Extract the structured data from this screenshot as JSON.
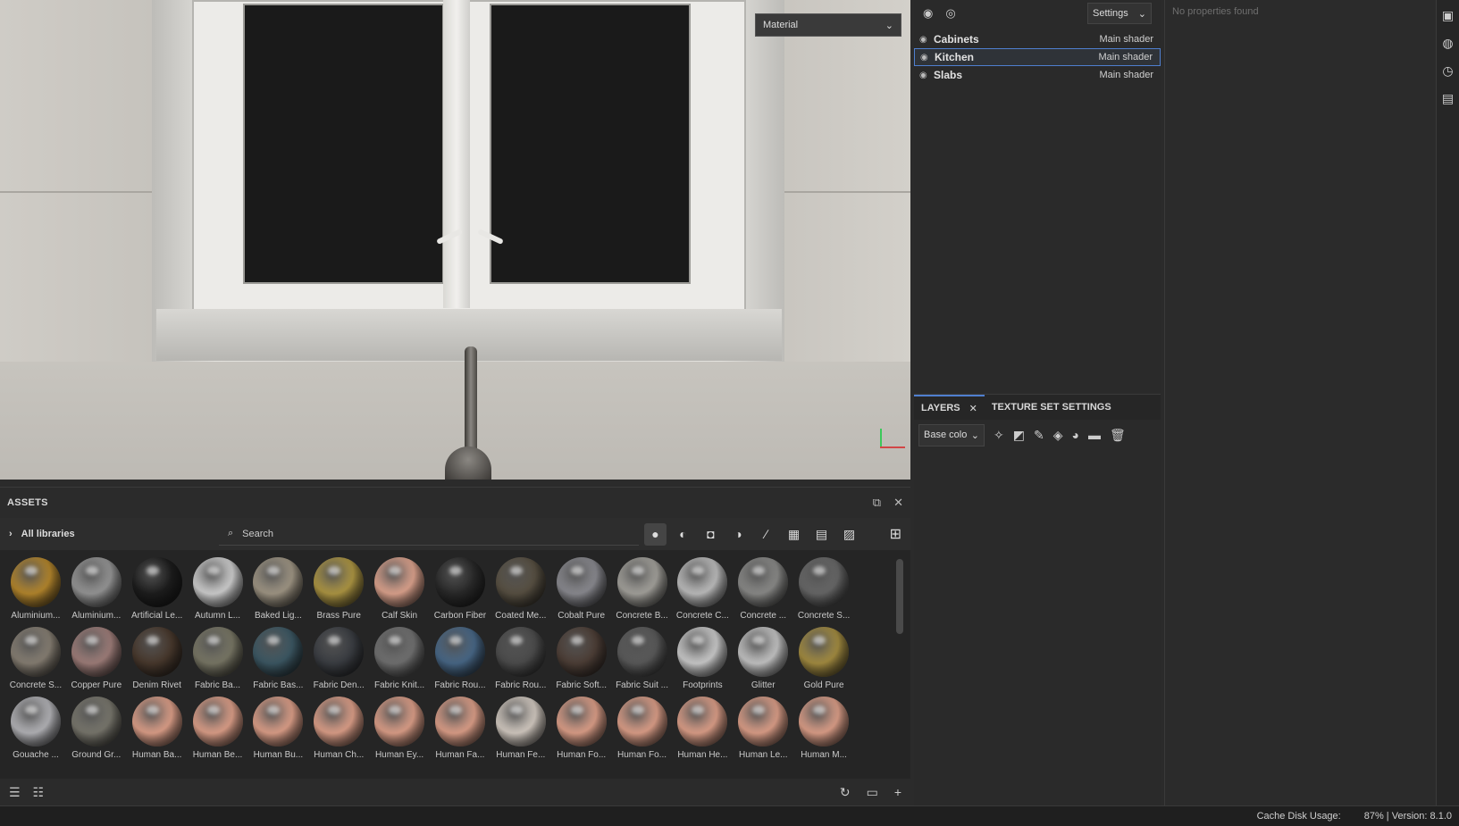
{
  "viewport": {
    "mode_dropdown": "Material"
  },
  "texture_sets": {
    "settings_label": "Settings",
    "items": [
      {
        "name": "Cabinets",
        "shader": "Main shader",
        "selected": false
      },
      {
        "name": "Kitchen",
        "shader": "Main shader",
        "selected": true
      },
      {
        "name": "Slabs",
        "shader": "Main shader",
        "selected": false
      }
    ]
  },
  "properties": {
    "empty_text": "No properties found"
  },
  "layers": {
    "tabs": [
      {
        "label": "LAYERS",
        "active": true
      },
      {
        "label": "TEXTURE SET SETTINGS",
        "active": false
      }
    ],
    "channel": "Base colo"
  },
  "assets": {
    "title": "ASSETS",
    "library": "All libraries",
    "search_placeholder": "Search",
    "items": [
      {
        "label": "Aluminium...",
        "color": "#b98a2e"
      },
      {
        "label": "Aluminium...",
        "color": "#9a9a9a"
      },
      {
        "label": "Artificial Le...",
        "color": "#1e1e1e"
      },
      {
        "label": "Autumn L...",
        "color": "#d4d4d4"
      },
      {
        "label": "Baked Lig...",
        "color": "#a49a88"
      },
      {
        "label": "Brass Pure",
        "color": "#b29a45"
      },
      {
        "label": "Calf Skin",
        "color": "#e2a791"
      },
      {
        "label": "Carbon Fiber",
        "color": "#2a2a2a"
      },
      {
        "label": "Coated Me...",
        "color": "#5a5244"
      },
      {
        "label": "Cobalt Pure",
        "color": "#8e8e94"
      },
      {
        "label": "Concrete B...",
        "color": "#a8a6a0"
      },
      {
        "label": "Concrete C...",
        "color": "#c2c2c2"
      },
      {
        "label": "Concrete ...",
        "color": "#8e8e8c"
      },
      {
        "label": "Concrete S...",
        "color": "#6a6a6a"
      },
      {
        "label": "Concrete S...",
        "color": "#8a8276"
      },
      {
        "label": "Copper Pure",
        "color": "#a3817d"
      },
      {
        "label": "Denim Rivet",
        "color": "#4a3a2e"
      },
      {
        "label": "Fabric Ba...",
        "color": "#7c7a68"
      },
      {
        "label": "Fabric Bas...",
        "color": "#3e5a66"
      },
      {
        "label": "Fabric Den...",
        "color": "#3c3f44"
      },
      {
        "label": "Fabric Knit...",
        "color": "#747474"
      },
      {
        "label": "Fabric Rou...",
        "color": "#4a6a8a"
      },
      {
        "label": "Fabric Rou...",
        "color": "#4e4e4e"
      },
      {
        "label": "Fabric Soft...",
        "color": "#4f4038"
      },
      {
        "label": "Fabric Suit ...",
        "color": "#5c5c5c"
      },
      {
        "label": "Footprints",
        "color": "#d0d0d0"
      },
      {
        "label": "Glitter",
        "color": "#c9c9c9"
      },
      {
        "label": "Gold Pure",
        "color": "#a89043"
      },
      {
        "label": "Gouache ...",
        "color": "#b8b8bc"
      },
      {
        "label": "Ground Gr...",
        "color": "#7c7a70"
      },
      {
        "label": "Human Ba...",
        "color": "#e2a38c"
      },
      {
        "label": "Human Be...",
        "color": "#e2a38c"
      },
      {
        "label": "Human Bu...",
        "color": "#e2a38c"
      },
      {
        "label": "Human Ch...",
        "color": "#e2a38c"
      },
      {
        "label": "Human Ey...",
        "color": "#e2a38c"
      },
      {
        "label": "Human Fa...",
        "color": "#e2a38c"
      },
      {
        "label": "Human Fe...",
        "color": "#d8cfc6"
      },
      {
        "label": "Human Fo...",
        "color": "#e2a38c"
      },
      {
        "label": "Human Fo...",
        "color": "#e2a38c"
      },
      {
        "label": "Human He...",
        "color": "#e2a38c"
      },
      {
        "label": "Human Le...",
        "color": "#e2a38c"
      },
      {
        "label": "Human M...",
        "color": "#e2a38c"
      }
    ]
  },
  "status": {
    "cache": "Cache Disk Usage:",
    "usage": "87% | Version: 8.1.0"
  }
}
